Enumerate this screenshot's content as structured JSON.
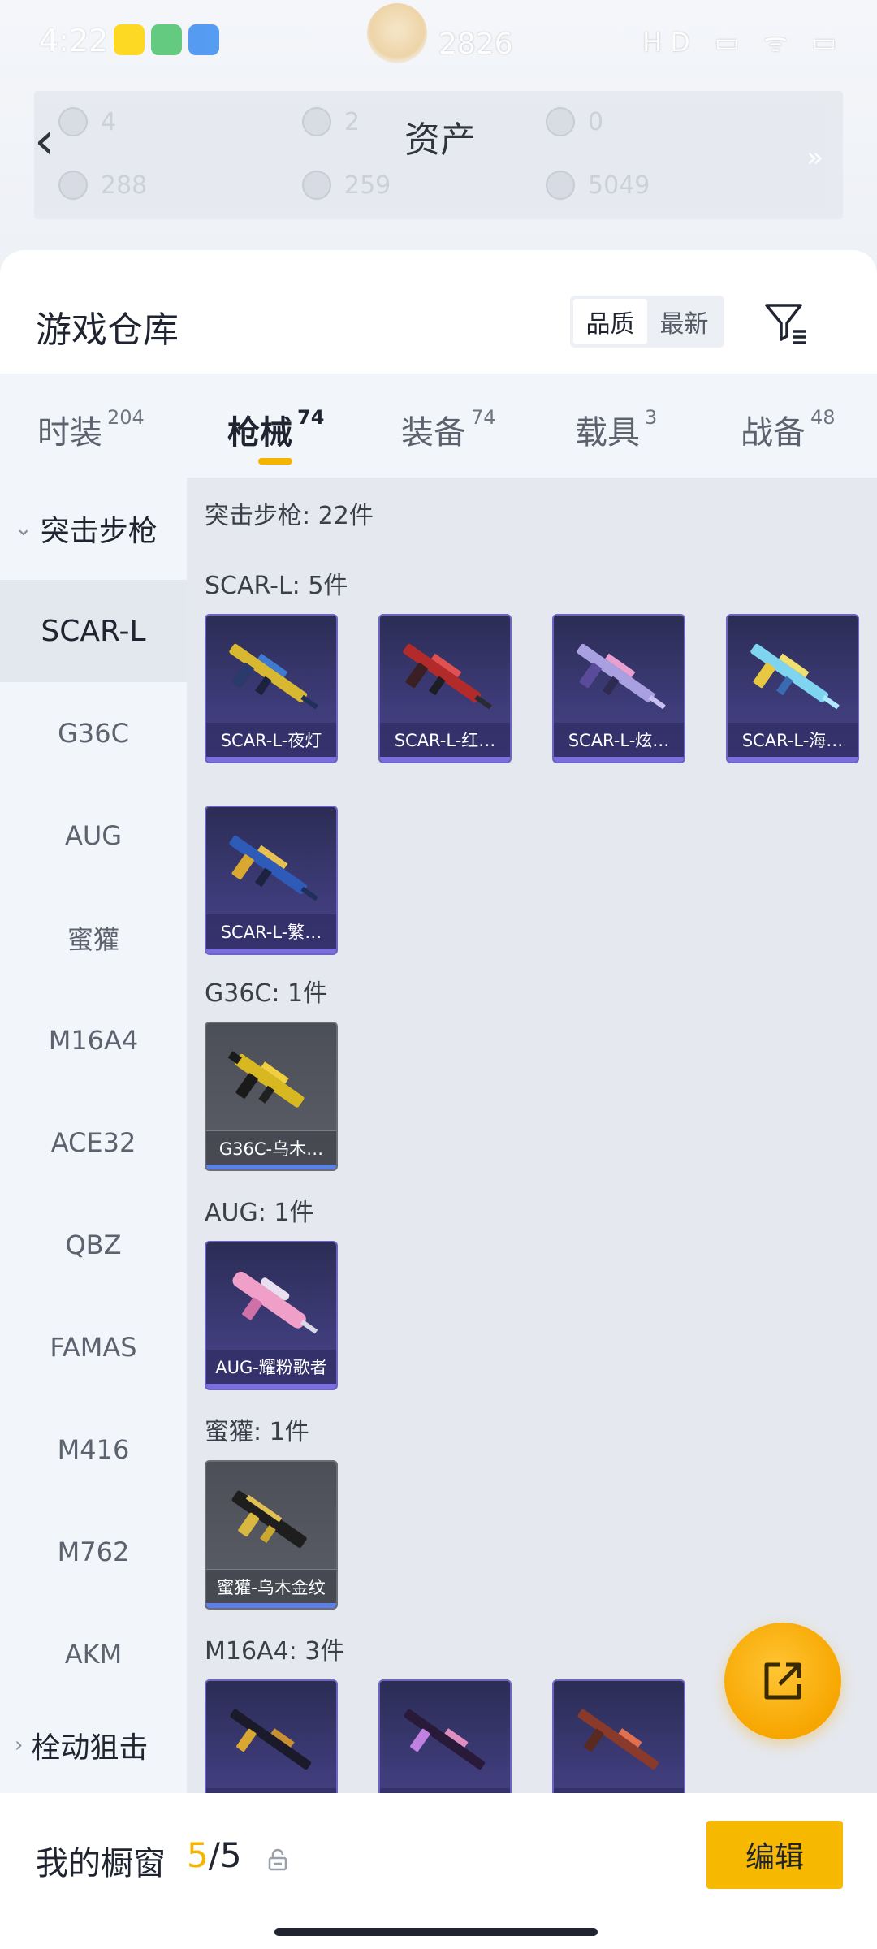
{
  "statusbar": {
    "time": "4:22",
    "rank_number": "2826",
    "system_icons": "HD ▭ ᯤ ▭"
  },
  "assets": {
    "title": "资产",
    "items": [
      "4",
      "2",
      "0",
      "288",
      "259",
      "5049"
    ]
  },
  "warehouse": {
    "title": "游戏仓库",
    "sort_options": [
      "品质",
      "最新"
    ],
    "active_sort": "品质"
  },
  "tabs": [
    {
      "label": "时装",
      "count": "204"
    },
    {
      "label": "枪械",
      "count": "74"
    },
    {
      "label": "装备",
      "count": "74"
    },
    {
      "label": "载具",
      "count": "3"
    },
    {
      "label": "战备",
      "count": "48"
    }
  ],
  "sidebar": {
    "group_expanded": "突击步枪",
    "items": [
      "SCAR-L",
      "G36C",
      "AUG",
      "蜜獾",
      "M16A4",
      "ACE32",
      "QBZ",
      "FAMAS",
      "M416",
      "M762",
      "AKM"
    ],
    "group_collapsed": "栓动狙击"
  },
  "content": {
    "category_heading": "突击步枪: 22件",
    "sections": [
      {
        "heading": "SCAR-L: 5件",
        "items": [
          "SCAR-L-夜灯",
          "SCAR-L-红…",
          "SCAR-L-炫…",
          "SCAR-L-海…",
          "SCAR-L-繁…"
        ]
      },
      {
        "heading": "G36C: 1件",
        "items": [
          "G36C-乌木…"
        ]
      },
      {
        "heading": "AUG: 1件",
        "items": [
          "AUG-耀粉歌者"
        ]
      },
      {
        "heading": "蜜獾: 1件",
        "items": [
          "蜜獾-乌木金纹"
        ]
      },
      {
        "heading": "M16A4: 3件",
        "items": [
          "",
          "",
          ""
        ]
      }
    ]
  },
  "bottom": {
    "label": "我的橱窗",
    "count_current": "5",
    "count_sep": "/5",
    "edit_label": "编辑"
  },
  "colors": {
    "accent": "#f5b400",
    "card_purple": "#3d3b78",
    "card_grey": "#5b5e67"
  }
}
